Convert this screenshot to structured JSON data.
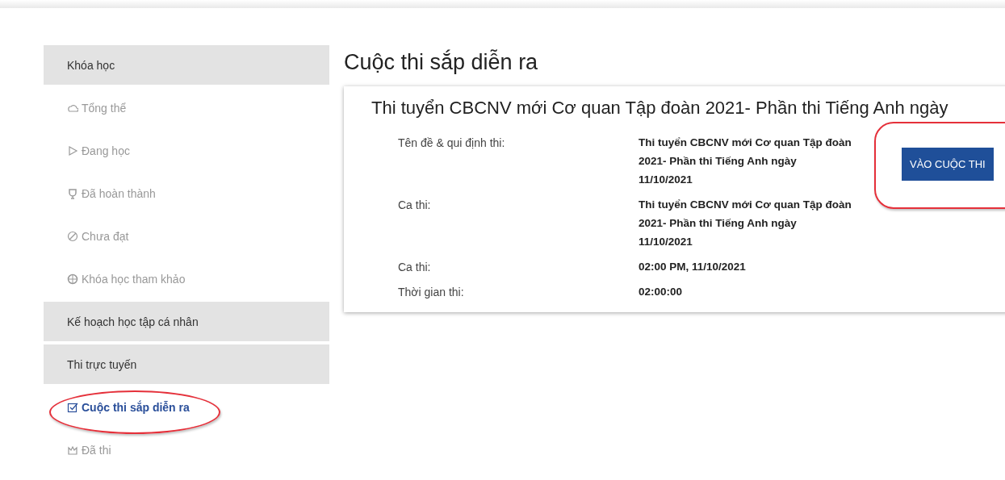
{
  "sidebar": {
    "sections": [
      {
        "title": "Khóa học",
        "items": [
          {
            "label": "Tổng thể",
            "selected": false,
            "circled": false
          },
          {
            "label": "Đang học",
            "selected": false,
            "circled": false
          },
          {
            "label": "Đã hoàn thành",
            "selected": false,
            "circled": false
          },
          {
            "label": "Chưa đạt",
            "selected": false,
            "circled": false
          },
          {
            "label": "Khóa học tham khảo",
            "selected": false,
            "circled": false
          }
        ]
      },
      {
        "title": "Kế hoạch học tập cá nhân"
      },
      {
        "title": "Thi trực tuyến",
        "items": [
          {
            "label": "Cuộc thi sắp diễn ra",
            "selected": true,
            "circled": true
          },
          {
            "label": "Đã thi",
            "selected": false,
            "circled": false
          }
        ]
      }
    ]
  },
  "page_title": "Cuộc thi sắp diễn ra",
  "exam_card": {
    "title": "Thi tuyển CBCNV mới Cơ quan Tập đoàn 2021- Phần thi Tiếng Anh ngày",
    "fields": [
      {
        "label": "Tên đề & qui định thi:",
        "value": "Thi tuyển CBCNV mới Cơ quan Tập đoàn 2021- Phần thi Tiếng Anh ngày 11/10/2021"
      },
      {
        "label": "Ca thi:",
        "value": "Thi tuyển CBCNV mới Cơ quan Tập đoàn 2021- Phần thi Tiếng Anh ngày 11/10/2021"
      },
      {
        "label": "Ca thi:",
        "value": "02:00 PM, 11/10/2021"
      },
      {
        "label": "Thời gian thi:",
        "value": "02:00:00"
      }
    ],
    "button": {
      "label": "VÀO CUỘC THI",
      "circled": true
    }
  }
}
